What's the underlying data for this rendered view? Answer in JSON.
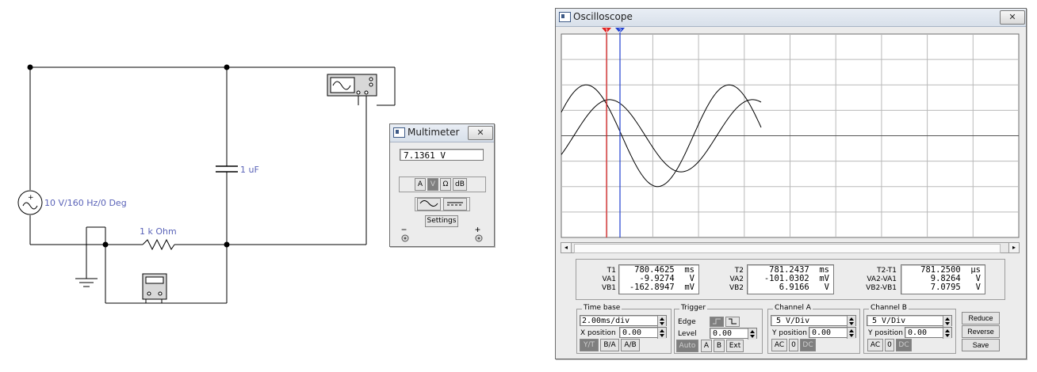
{
  "circuit": {
    "source_label": "10 V/160 Hz/0 Deg",
    "capacitor_label": "1 uF",
    "resistor_label": "1 k Ohm"
  },
  "multimeter": {
    "title": "Multimeter",
    "close_label": "✕",
    "reading": "7.1361  V",
    "mode_buttons": [
      "A",
      "V",
      "Ω",
      "dB"
    ],
    "active_mode": "V",
    "settings_label": "Settings",
    "minus_label": "−",
    "plus_label": "+"
  },
  "oscilloscope": {
    "title": "Oscilloscope",
    "close_label": "✕",
    "cursor1_label": "1",
    "cursor2_label": "2",
    "readouts": {
      "t1": {
        "label": "T1",
        "value": "780.4625  ms"
      },
      "va1": {
        "label": "VA1",
        "value": "-9.9274   V"
      },
      "vb1": {
        "label": "VB1",
        "value": "-162.8947  mV"
      },
      "t2": {
        "label": "T2",
        "value": "781.2437  ms"
      },
      "va2": {
        "label": "VA2",
        "value": "-101.0302  mV"
      },
      "vb2": {
        "label": "VB2",
        "value": "6.9166   V"
      },
      "dt": {
        "label": "T2-T1",
        "value": "781.2500  µs"
      },
      "dva": {
        "label": "VA2-VA1",
        "value": "9.8264   V"
      },
      "dvb": {
        "label": "VB2-VB1",
        "value": "7.0795   V"
      }
    },
    "timebase": {
      "title": "Time base",
      "value": "2.00ms/div",
      "xpos_label": "X position",
      "xpos_value": "0.00",
      "modes": [
        "Y/T",
        "B/A",
        "A/B"
      ],
      "active_mode": "Y/T"
    },
    "trigger": {
      "title": "Trigger",
      "edge_label": "Edge",
      "level_label": "Level",
      "level_value": "0.00",
      "buttons": [
        "Auto",
        "A",
        "B",
        "Ext"
      ],
      "active": "Auto"
    },
    "channel_a": {
      "title": "Channel A",
      "scale": "5  V/Div",
      "ypos_label": "Y position",
      "ypos_value": "0.00",
      "coupling": [
        "AC",
        "0",
        "DC"
      ],
      "active": "DC"
    },
    "channel_b": {
      "title": "Channel B",
      "scale": "5  V/Div",
      "ypos_label": "Y position",
      "ypos_value": "0.00",
      "coupling": [
        "AC",
        "0",
        "DC"
      ],
      "active": "DC"
    },
    "side_buttons": [
      "Reduce",
      "Reverse",
      "Save"
    ],
    "scroll_left": "◂",
    "scroll_right": "▸",
    "colors": {
      "cursor1": "#e02020",
      "cursor2": "#2040d0",
      "trace": "#000000",
      "grid": "#b9b9b9"
    }
  }
}
